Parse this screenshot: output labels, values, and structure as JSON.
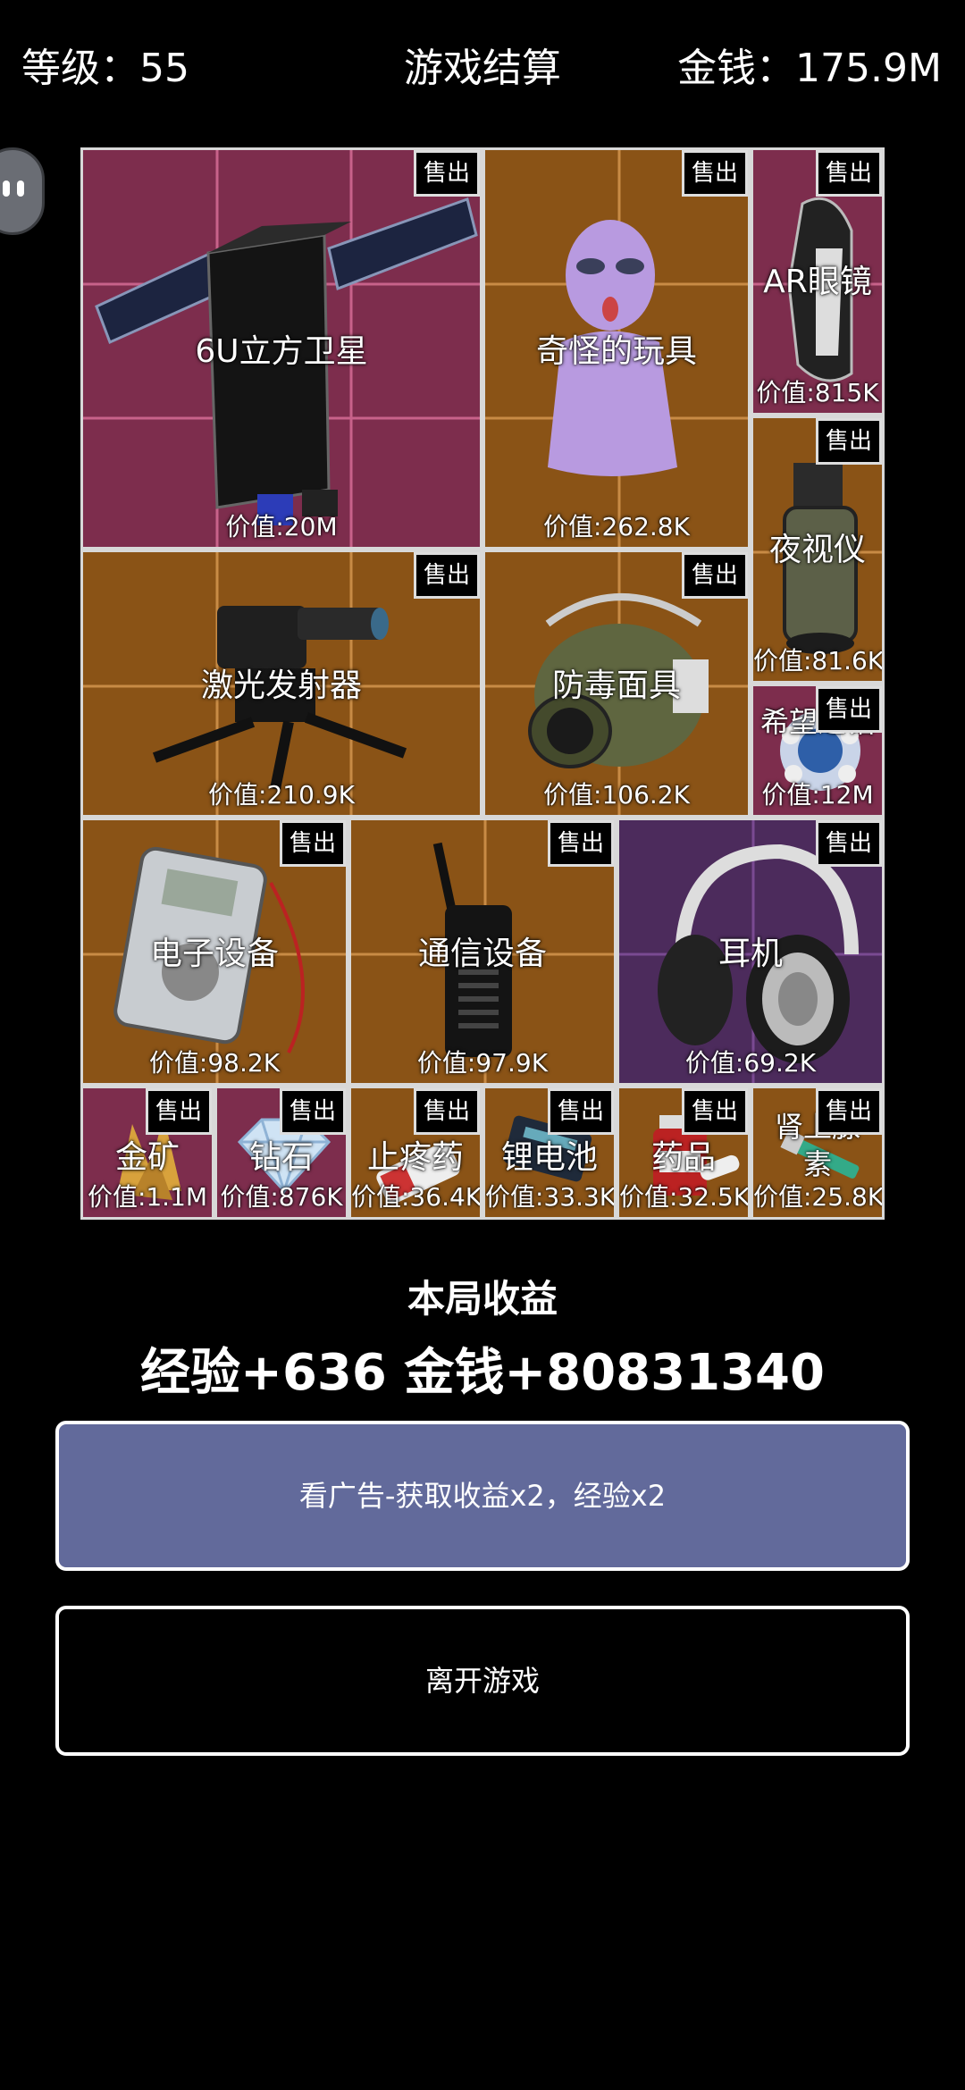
{
  "header": {
    "level": "等级：55",
    "title": "游戏结算",
    "money": "金钱：175.9M"
  },
  "sell_label": "售出",
  "items": [
    {
      "name": "6U立方卫星",
      "price": "价值:20M"
    },
    {
      "name": "奇怪的玩具",
      "price": "价值:262.8K"
    },
    {
      "name": "AR眼镜",
      "price": "价值:815K"
    },
    {
      "name": "夜视仪",
      "price": "价值:81.6K"
    },
    {
      "name": "激光发射器",
      "price": "价值:210.9K"
    },
    {
      "name": "防毒面具",
      "price": "价值:106.2K"
    },
    {
      "name": "希望之钻",
      "price": "价值:12M"
    },
    {
      "name": "电子设备",
      "price": "价值:98.2K"
    },
    {
      "name": "通信设备",
      "price": "价值:97.9K"
    },
    {
      "name": "耳机",
      "price": "价值:69.2K"
    },
    {
      "name": "金矿",
      "price": "价值:1.1M"
    },
    {
      "name": "钻石",
      "price": "价值:876K"
    },
    {
      "name": "止疼药",
      "price": "价值:36.4K"
    },
    {
      "name": "锂电池",
      "price": "价值:33.3K"
    },
    {
      "name": "药品",
      "price": "价值:32.5K"
    },
    {
      "name": "肾上腺素",
      "price": "价值:25.8K"
    }
  ],
  "summary": {
    "title": "本局收益",
    "rewards": "经验+636 金钱+80831340"
  },
  "buttons": {
    "ad": "看广告-获取收益x2，经验x2",
    "leave": "离开游戏"
  }
}
